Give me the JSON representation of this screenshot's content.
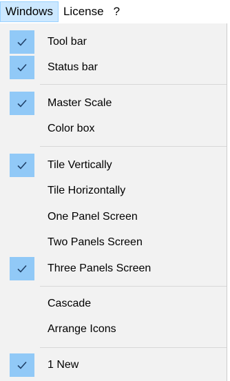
{
  "menubar": {
    "items": [
      {
        "label": "Windows",
        "active": true
      },
      {
        "label": "License",
        "active": false
      },
      {
        "label": "?",
        "active": false
      }
    ]
  },
  "dropdown": {
    "check_color": "#91c9f7",
    "items": [
      {
        "label": "Tool bar",
        "checked": true
      },
      {
        "label": "Status bar",
        "checked": true
      },
      {
        "label": "Master Scale",
        "checked": true
      },
      {
        "label": "Color box",
        "checked": false
      },
      {
        "label": "Tile Vertically",
        "checked": true
      },
      {
        "label": "Tile Horizontally",
        "checked": false
      },
      {
        "label": "One Panel Screen",
        "checked": false
      },
      {
        "label": "Two Panels Screen",
        "checked": false
      },
      {
        "label": "Three Panels Screen",
        "checked": true
      },
      {
        "label": "Cascade",
        "checked": false
      },
      {
        "label": "Arrange Icons",
        "checked": false
      },
      {
        "label": "1 New",
        "checked": true
      }
    ]
  }
}
